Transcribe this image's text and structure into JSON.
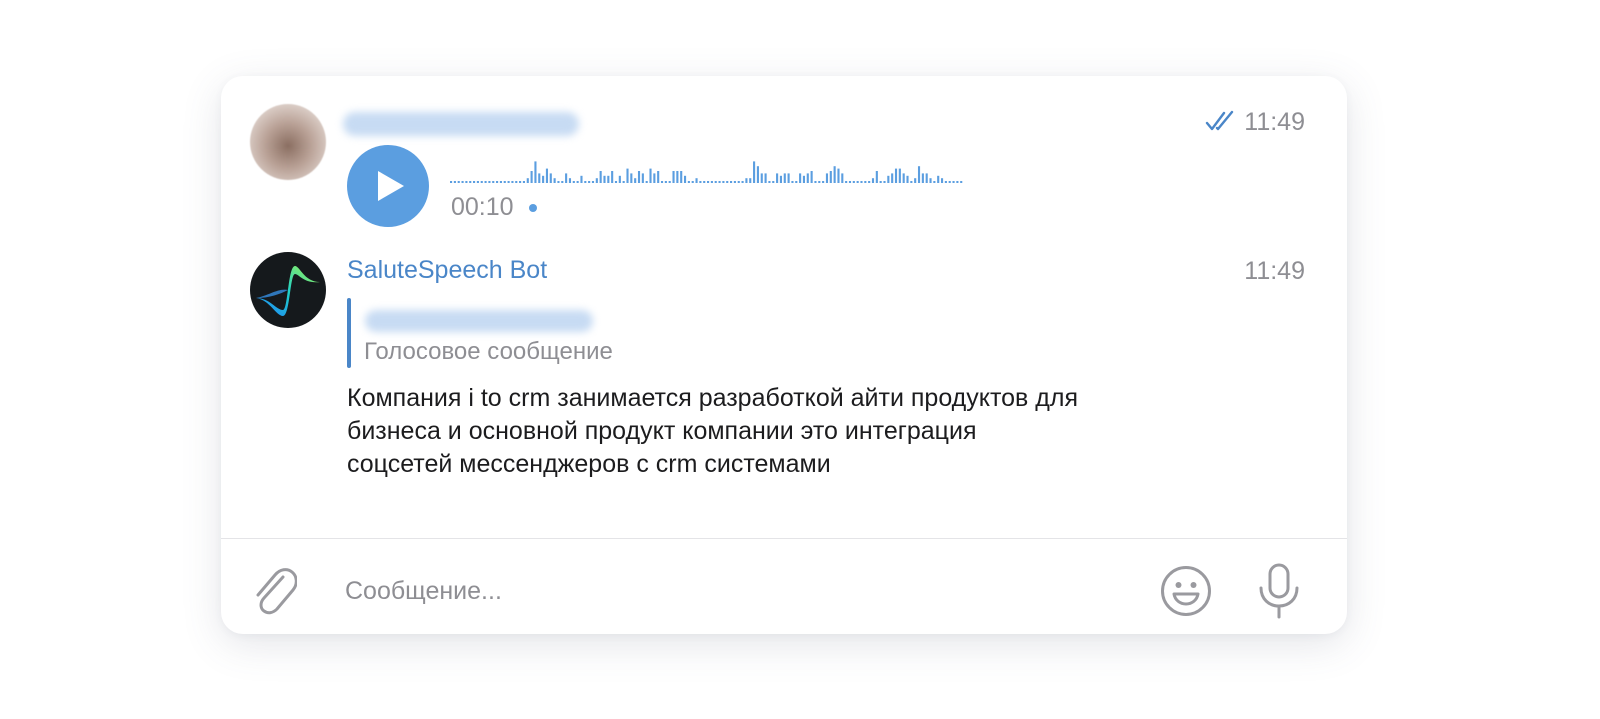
{
  "colors": {
    "accent": "#4a86c8",
    "play_button": "#5b9ee0",
    "secondary_text": "#8e8e93",
    "primary_text": "#1c1c1e"
  },
  "voice_message": {
    "time": "11:49",
    "duration": "00:10",
    "status_icon": "double-check-icon",
    "play_icon": "play-icon"
  },
  "bot_message": {
    "sender": "SaluteSpeech Bot",
    "time": "11:49",
    "reply_preview": "Голосовое сообщение",
    "text_lines": [
      "Компания i to crm занимается разработкой айти продуктов для",
      "бизнеса и основной продукт компании это интеграция",
      "соцсетей мессенджеров с crm системами"
    ]
  },
  "composer": {
    "placeholder": "Сообщение...",
    "value": "",
    "icons": [
      "paperclip-icon",
      "smiley-icon",
      "microphone-icon"
    ]
  }
}
